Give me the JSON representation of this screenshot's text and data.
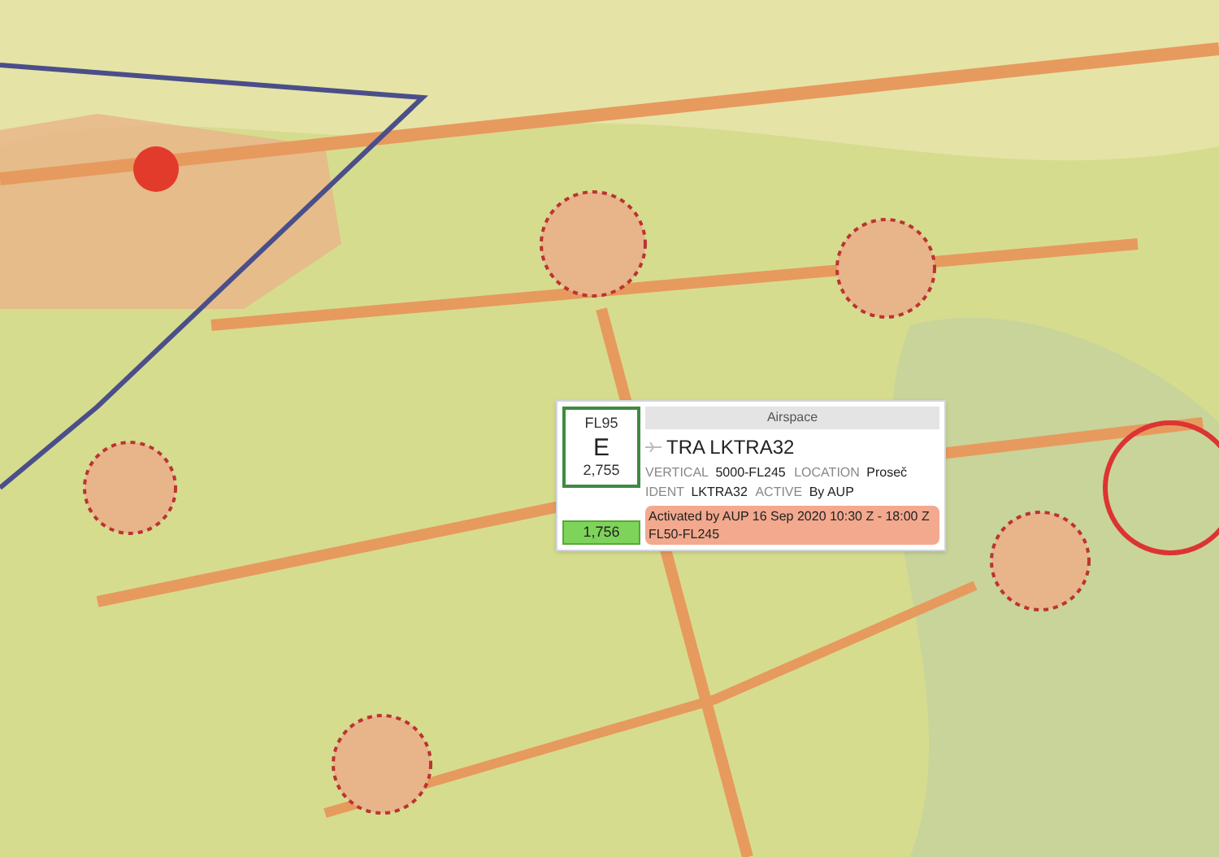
{
  "popup": {
    "box": {
      "level": "FL95",
      "class": "E",
      "altitude": "2,755",
      "ground": "1,756"
    },
    "header": "Airspace",
    "title": "TRA LKTRA32",
    "fields": [
      {
        "label": "VERTICAL",
        "value": "5000-FL245"
      },
      {
        "label": "LOCATION",
        "value": "Proseč"
      },
      {
        "label": "IDENT",
        "value": "LKTRA32"
      },
      {
        "label": "ACTIVE",
        "value": "By AUP"
      }
    ],
    "note": "Activated by AUP 16 Sep 2020 10:30 Z - 18:00 Z FL50-FL245"
  }
}
